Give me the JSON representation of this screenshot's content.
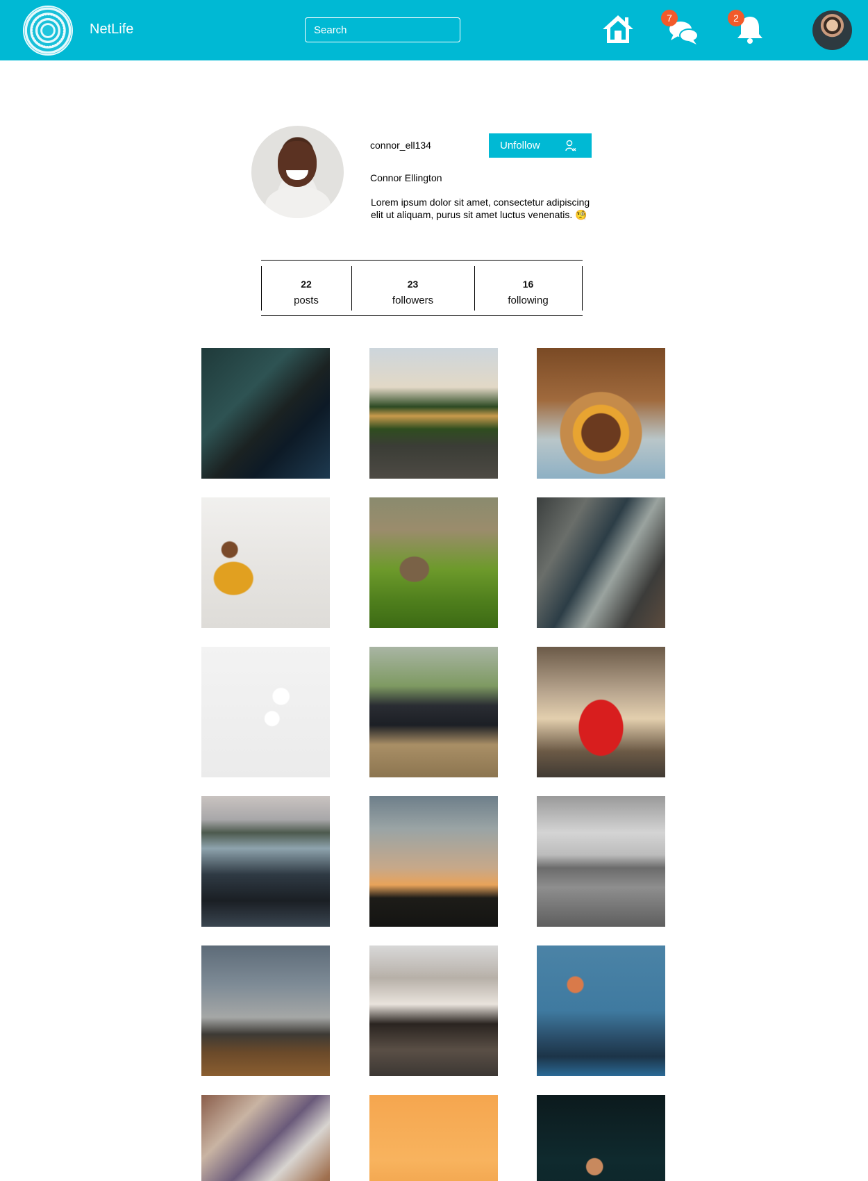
{
  "app": {
    "name": "NetLife"
  },
  "search": {
    "placeholder": "Search"
  },
  "nav": {
    "messages_badge": "7",
    "notifications_badge": "2"
  },
  "profile": {
    "username": "connor_ell134",
    "full_name": "Connor Ellington",
    "bio": "Lorem ipsum dolor sit amet, consectetur adipiscing elit ut aliquam, purus sit amet luctus venenatis. 🧐",
    "unfollow_label": "Unfollow"
  },
  "stats": [
    {
      "value": "22",
      "label": "posts"
    },
    {
      "value": "23",
      "label": "followers"
    },
    {
      "value": "16",
      "label": "following"
    }
  ],
  "colors": {
    "accent": "#00b9d4",
    "badge": "#f25a2a"
  },
  "posts": [
    {
      "name": "car-dashboard",
      "bg": "linear-gradient(135deg,#1f3a3a 0%,#2e5353 35%,#1b2222 55%,#0d1a26 70%,#1e3a50 100%)"
    },
    {
      "name": "countryside-field",
      "bg": "linear-gradient(180deg,#cdd6dc 0%,#e2d8c6 30%,#2c4a23 45%,#c89a4c 52%,#2f4d1f 62%,#3b3d36 75%,#4d4a44 100%)"
    },
    {
      "name": "burger",
      "bg": "radial-gradient(circle at 50% 65%,#6b3a1f 0 18%,#e8a431 19% 26%,#c58b4a 27% 38%,transparent 39%),linear-gradient(180deg,#7a4a25 0%,#a06a3d 40%,#b9c6c9 70%,#8db0c4 100%)"
    },
    {
      "name": "boy-on-slope",
      "bg": "radial-gradient(ellipse at 25% 62%,#e1a020 0 14%,transparent 15%),radial-gradient(circle at 22% 40%,#7a4a2a 0 6%,transparent 7%),linear-gradient(180deg,#f1f0ee 0%,#e7e5e2 50%,#dedcd8 100%)"
    },
    {
      "name": "bird-in-grass",
      "bg": "radial-gradient(ellipse at 35% 55%,#7a6247 0 12%,transparent 13%),linear-gradient(180deg,#8a8b6e 0%,#9b8c6c 25%,#6d9a2b 55%,#4e7e1c 80%,#3c6a14 100%)"
    },
    {
      "name": "city-skyscrapers",
      "bg": "linear-gradient(120deg,#3b3f3e 0%,#6a6e6a 25%,#2c3d46 45%,#9aa39f 60%,#3c3c3a 80%,#5d4c3e 100%)"
    },
    {
      "name": "earphones",
      "bg": "radial-gradient(circle at 62% 38%,#ffffff 0 7%,transparent 8%),radial-gradient(circle at 55% 55%,#ffffff 0 7%,transparent 8%),linear-gradient(180deg,#f3f3f3 0%,#ebebeb 100%)"
    },
    {
      "name": "phone-on-table",
      "bg": "linear-gradient(180deg,#a9b5a4 0%,#7e9a62 30%,#2a2d33 45%,#1c1f25 60%,#a98f66 75%,#8c7550 100%)"
    },
    {
      "name": "red-sports-car",
      "bg": "radial-gradient(ellipse at 50% 62%,#d81e1e 0 24%,transparent 25%),linear-gradient(180deg,#6b5a48 0%,#b9a68f 35%,#e3cfae 55%,#6c5a46 80%,#403a33 100%)"
    },
    {
      "name": "rocky-shore",
      "bg": "linear-gradient(180deg,#c9c3c0 0%,#a8a7a9 18%,#4d5a4e 28%,#8ea3ad 40%,#2f3a44 60%,#1a1f24 80%,#3a4550 100%)"
    },
    {
      "name": "sunset-trees",
      "bg": "linear-gradient(180deg,#6e7f8a 0%,#9aa4a5 25%,#c7a889 55%,#e8a35a 68%,#1d1c18 78%,#141412 100%)"
    },
    {
      "name": "grey-field",
      "bg": "linear-gradient(180deg,#9a9a9a 0%,#d4d4d4 28%,#bcbcbc 45%,#6b6b6b 55%,#8e8e8e 70%,#5e5e5e 100%)"
    },
    {
      "name": "hills-with-moon",
      "bg": "linear-gradient(180deg,#5d6b78 0%,#7e8b96 30%,#a5a7a6 55%,#3d3a35 68%,#6b4a2a 82%,#8a5e30 100%)"
    },
    {
      "name": "tudor-house",
      "bg": "linear-gradient(180deg,#d8d8d8 0%,#b7b0a8 25%,#e9e3dc 45%,#2a2420 60%,#5a4f46 80%,#3c3733 100%)"
    },
    {
      "name": "city-skyline-moon",
      "bg": "radial-gradient(circle at 30% 30%,#d97a4a 0 6%,transparent 7%),linear-gradient(180deg,#4b83a6 0%,#3f7aa0 50%,#2b4f6b 70%,#1c3448 85%,#2a6a96 100%)"
    },
    {
      "name": "tea-set",
      "bg": "linear-gradient(135deg,#8a5d4a 0%,#c9b4a3 25%,#6a5a7a 45%,#d8d4d0 60%,#a0704f 80%,#5a4a3a 100%)"
    },
    {
      "name": "ocean-sunset",
      "bg": "radial-gradient(circle at 50% 80%,#ffe9a8 0 8%,transparent 9%),linear-gradient(180deg,#f5a64f 0%,#f8b35e 50%,#f0a048 80%,#2a2a30 92%,#1a1a20 100%)"
    },
    {
      "name": "swimmer",
      "bg": "radial-gradient(ellipse at 45% 55%,#c8895e 0 8%,transparent 9%),linear-gradient(180deg,#0c1a1d 0%,#0f2a2e 50%,#0b2125 100%)"
    }
  ]
}
